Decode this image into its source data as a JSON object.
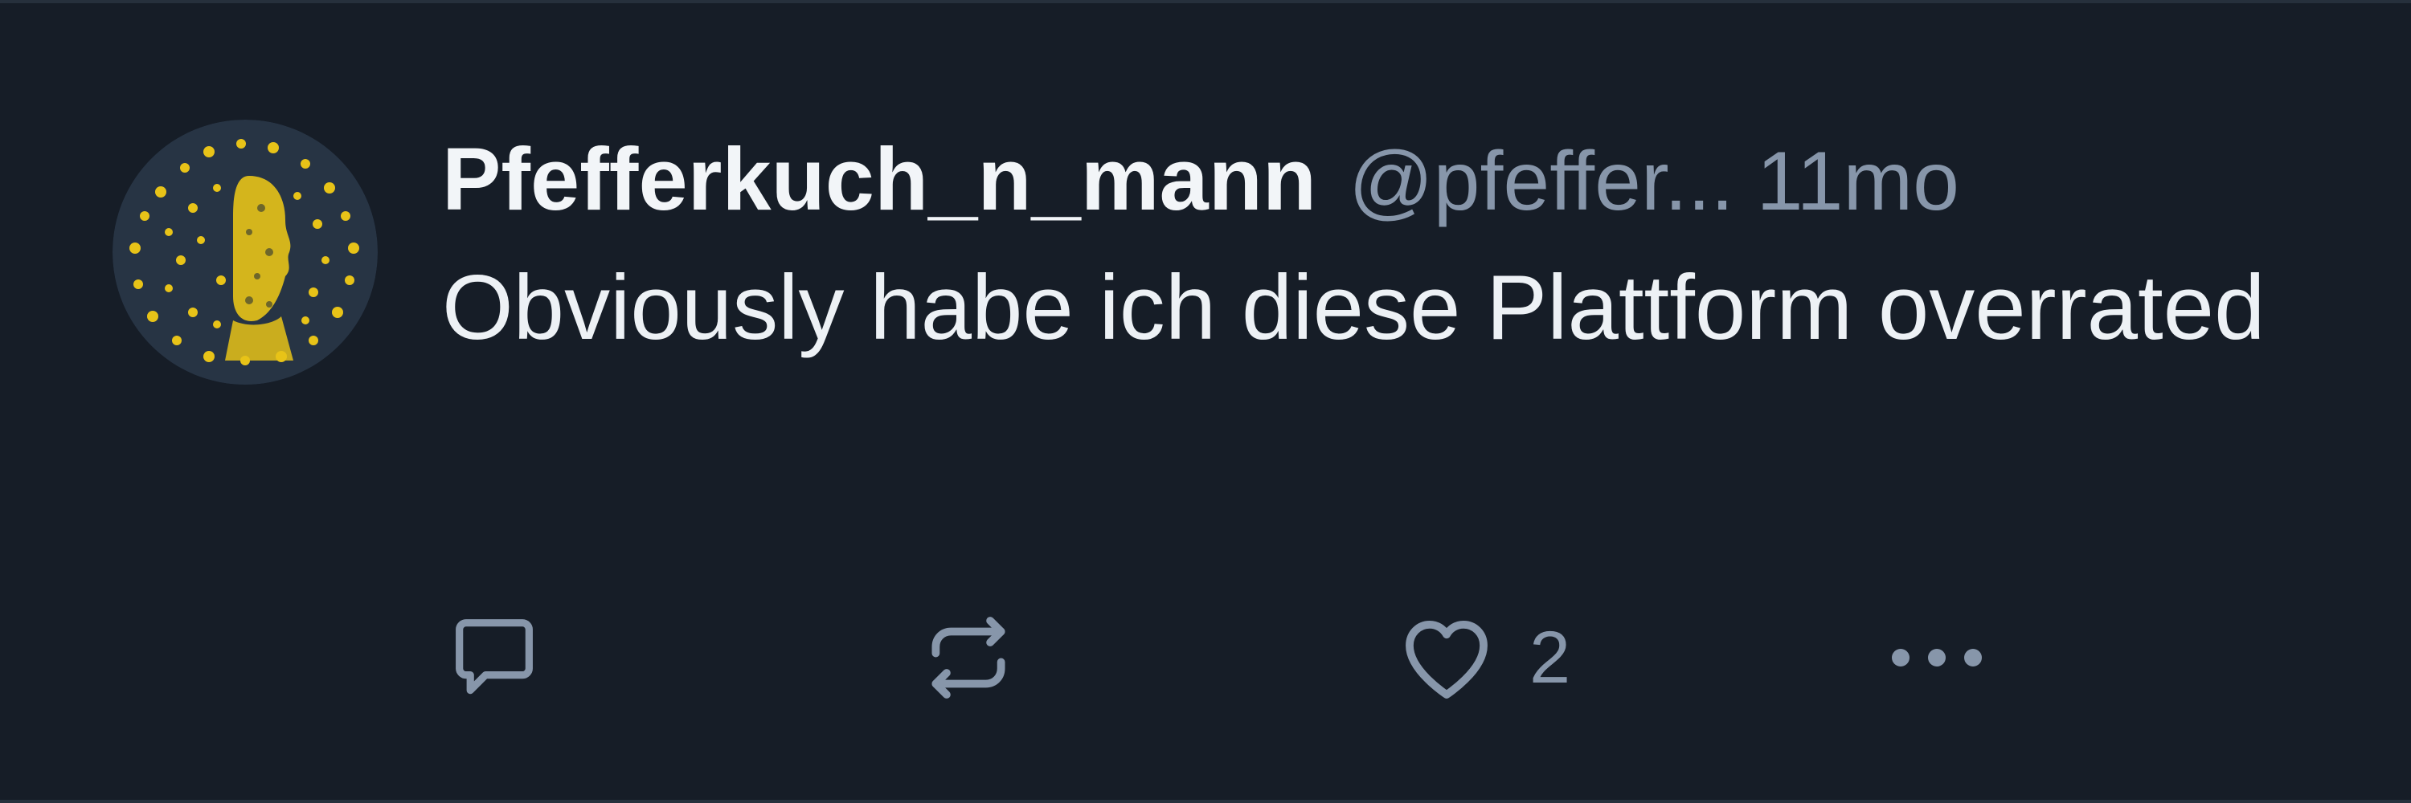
{
  "post": {
    "display_name": "Pfefferkuch_n_mann",
    "handle": "@pfeffer...",
    "timestamp": "11mo",
    "text": "Obviously habe ich diese Plattform overrated",
    "actions": {
      "reply_icon": "speech-bubble",
      "repost_icon": "repost-arrows",
      "like_icon": "heart-outline",
      "like_count": "2",
      "more_icon": "three-dots"
    }
  },
  "colors": {
    "background": "#161d27",
    "primary_text": "#f2f5f8",
    "secondary_text": "#8796aa",
    "avatar_accent": "#e8c318"
  }
}
